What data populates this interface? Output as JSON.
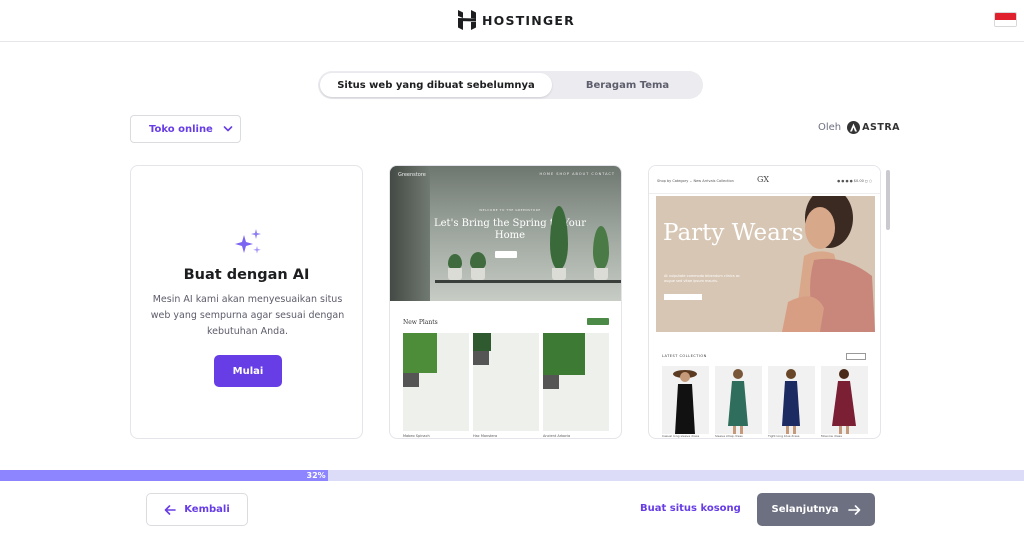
{
  "header": {
    "brand": "HOSTINGER",
    "language_flag": "id-flag-icon"
  },
  "tabs": [
    {
      "label": "Situs web yang dibuat sebelumnya",
      "active": true
    },
    {
      "label": "Beragam Tema",
      "active": false
    }
  ],
  "filter": {
    "selected": "Toko online"
  },
  "byline": {
    "prefix": "Oleh",
    "brand": "ASTRA"
  },
  "ai_card": {
    "title": "Buat dengan AI",
    "description": "Mesin AI kami akan menyesuaikan situs web yang sempurna agar sesuai dengan kebutuhan Anda.",
    "button": "Mulai"
  },
  "templates": [
    {
      "name": "plants-store-template",
      "hero_text": "Let's Bring the Spring to Your Home",
      "section": "New Plants"
    },
    {
      "name": "fashion-store-template",
      "hero_text": "Party Wears"
    }
  ],
  "progress": {
    "percent": 32,
    "label": "32%"
  },
  "footer": {
    "back": "Kembali",
    "empty_site": "Buat situs kosong",
    "next": "Selanjutnya"
  },
  "colors": {
    "accent": "#673de6",
    "progress_fill": "#8c85ff",
    "progress_track": "#dcdcf8",
    "next_button": "#6d7081"
  }
}
